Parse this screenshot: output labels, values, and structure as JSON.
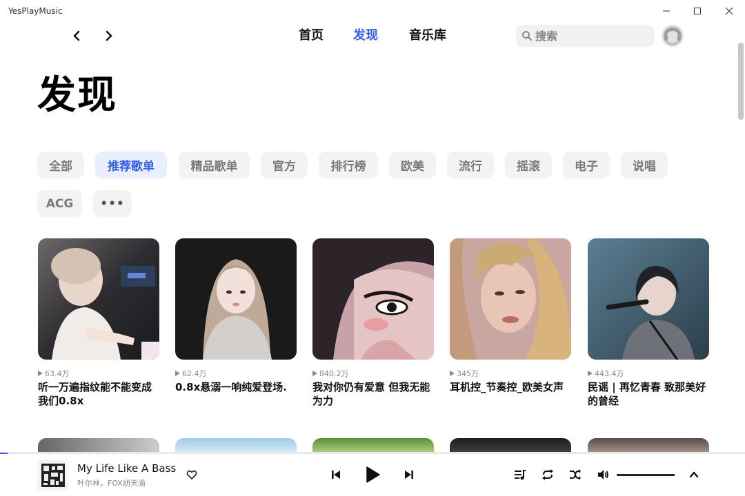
{
  "window": {
    "app_title": "YesPlayMusic"
  },
  "nav": {
    "tabs": [
      {
        "label": "首页",
        "active": false
      },
      {
        "label": "发现",
        "active": true
      },
      {
        "label": "音乐库",
        "active": false
      }
    ],
    "search_placeholder": "搜索"
  },
  "page": {
    "title": "发现"
  },
  "categories": [
    {
      "label": "全部",
      "active": false
    },
    {
      "label": "推荐歌单",
      "active": true
    },
    {
      "label": "精品歌单",
      "active": false
    },
    {
      "label": "官方",
      "active": false
    },
    {
      "label": "排行榜",
      "active": false
    },
    {
      "label": "欧美",
      "active": false
    },
    {
      "label": "流行",
      "active": false
    },
    {
      "label": "摇滚",
      "active": false
    },
    {
      "label": "电子",
      "active": false
    },
    {
      "label": "说唱",
      "active": false
    },
    {
      "label": "ACG",
      "active": false
    },
    {
      "label": "•••",
      "active": false
    }
  ],
  "playlists": [
    {
      "play_count": "63.4万",
      "title": "听一万遍指纹能不能变成我们0.8x"
    },
    {
      "play_count": "62.4万",
      "title": "0.8x悬溺一响纯爱登场."
    },
    {
      "play_count": "840.2万",
      "title": "我对你仍有爱意 但我无能为力"
    },
    {
      "play_count": "345万",
      "title": "耳机控_节奏控_欧美女声"
    },
    {
      "play_count": "443.4万",
      "title": "民谣 | 再忆青春 致那美好的曾经"
    }
  ],
  "player": {
    "track_title": "My Life Like A Bass",
    "track_artist": "叶尔林，FOX胡天渝",
    "progress": 0.01,
    "volume": 1.0
  },
  "colors": {
    "accent": "#335eea",
    "chip_bg": "#f3f3f5",
    "chip_active_bg": "#eaeffd"
  }
}
